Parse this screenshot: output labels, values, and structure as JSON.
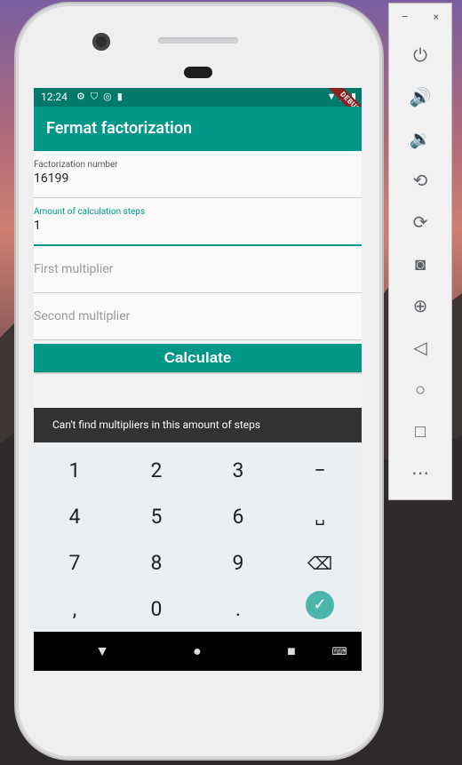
{
  "status_bar": {
    "time": "12:24",
    "left_icons": [
      "gear-icon",
      "shield-icon",
      "sync-icon",
      "sdcard-icon"
    ],
    "right_icons": [
      "wifi-icon",
      "signal-icon",
      "battery-icon"
    ],
    "debug_label": "DEBUG"
  },
  "app_bar": {
    "title": "Fermat factorization"
  },
  "form": {
    "factorization_number": {
      "label": "Factorization number",
      "value": "16199"
    },
    "steps": {
      "label": "Amount of calculation steps",
      "value": "1"
    },
    "first_multiplier": {
      "placeholder": "First multiplier"
    },
    "second_multiplier": {
      "placeholder": "Second multiplier"
    },
    "calculate_label": "Calculate"
  },
  "snackbar": {
    "message": "Can't find multipliers in this amount of steps"
  },
  "keypad": {
    "rows": [
      [
        "1",
        "2",
        "3",
        "−"
      ],
      [
        "4",
        "5",
        "6",
        "␣"
      ],
      [
        "7",
        "8",
        "9",
        "⌫"
      ],
      [
        ",",
        "0",
        ".",
        "✓"
      ]
    ]
  },
  "nav_bar": {
    "back": "▼",
    "home": "●",
    "recents": "■",
    "keyboard": "⌨"
  },
  "emulator_toolbar": {
    "minimize": "–",
    "close": "×",
    "buttons": [
      "power-icon",
      "volume-up-icon",
      "volume-down-icon",
      "rotate-left-icon",
      "rotate-right-icon",
      "camera-icon",
      "zoom-icon",
      "back-icon",
      "home-icon",
      "overview-icon",
      "more-icon"
    ]
  },
  "colors": {
    "primary": "#009688",
    "primary_dark": "#00796b",
    "snackbar": "#323232",
    "accent_check": "#4db6ac"
  }
}
